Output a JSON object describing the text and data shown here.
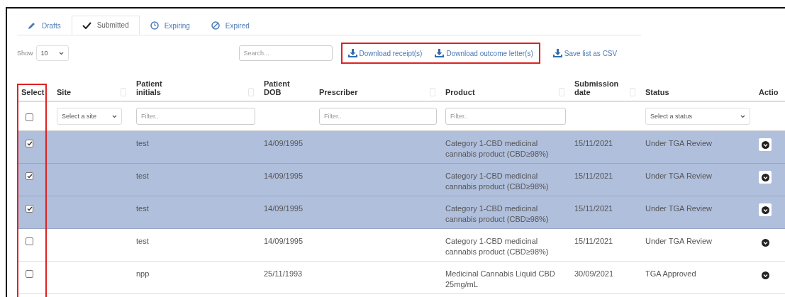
{
  "tabs": [
    {
      "label": "Drafts",
      "kind": "drafts",
      "selected": false
    },
    {
      "label": "Submitted",
      "kind": "submitted",
      "selected": true
    },
    {
      "label": "Expiring",
      "kind": "expiring",
      "selected": false
    },
    {
      "label": "Expired",
      "kind": "expired",
      "selected": false
    }
  ],
  "toolbar": {
    "show_label": "Show",
    "page_size": "10",
    "search_placeholder": "Search...",
    "actions": [
      {
        "label": "Download receipt(s)",
        "highlighted": true
      },
      {
        "label": "Download outcome letter(s)",
        "highlighted": true
      },
      {
        "label": "Save list as CSV",
        "highlighted": false
      }
    ]
  },
  "table": {
    "select_column_highlighted": true,
    "columns": [
      {
        "label": "Select",
        "sortable": false,
        "filter": {
          "kind": "checkbox",
          "checked": false
        }
      },
      {
        "label": "Site",
        "sortable": true,
        "filter": {
          "kind": "select",
          "placeholder": "Select a site"
        }
      },
      {
        "label": "Patient initials",
        "sortable": true,
        "filter": {
          "kind": "text",
          "placeholder": "Filter.."
        }
      },
      {
        "label": "Patient DOB",
        "sortable": false,
        "filter": {
          "kind": "none"
        }
      },
      {
        "label": "Prescriber",
        "sortable": true,
        "filter": {
          "kind": "text",
          "placeholder": "Filter.."
        }
      },
      {
        "label": "Product",
        "sortable": true,
        "filter": {
          "kind": "text",
          "placeholder": "Filter.."
        }
      },
      {
        "label": "Submission date",
        "sortable": true,
        "filter": {
          "kind": "none"
        }
      },
      {
        "label": "Status",
        "sortable": false,
        "filter": {
          "kind": "select",
          "placeholder": "Select a status"
        }
      },
      {
        "label": "Actio",
        "filter": {
          "kind": "none"
        }
      }
    ],
    "rows": [
      {
        "selected": true,
        "checked": true,
        "initials": "test",
        "dob": "14/09/1995",
        "product": "Category 1-CBD medicinal cannabis product (CBD≥98%)",
        "date": "15/11/2021",
        "status": "Under TGA Review"
      },
      {
        "selected": true,
        "checked": true,
        "initials": "test",
        "dob": "14/09/1995",
        "product": "Category 1-CBD medicinal cannabis product (CBD≥98%)",
        "date": "15/11/2021",
        "status": "Under TGA Review"
      },
      {
        "selected": true,
        "checked": true,
        "initials": "test",
        "dob": "14/09/1995",
        "product": "Category 1-CBD medicinal cannabis product (CBD≥98%)",
        "date": "15/11/2021",
        "status": "Under TGA Review"
      },
      {
        "selected": false,
        "checked": false,
        "initials": "test",
        "dob": "14/09/1995",
        "product": "Category 1-CBD medicinal cannabis product (CBD≥98%)",
        "date": "15/11/2021",
        "status": "Under TGA Review"
      },
      {
        "selected": false,
        "checked": false,
        "initials": "npp",
        "dob": "25/11/1993",
        "product": "Medicinal Cannabis Liquid CBD 25mg/mL",
        "date": "30/09/2021",
        "status": "TGA Approved"
      }
    ]
  }
}
